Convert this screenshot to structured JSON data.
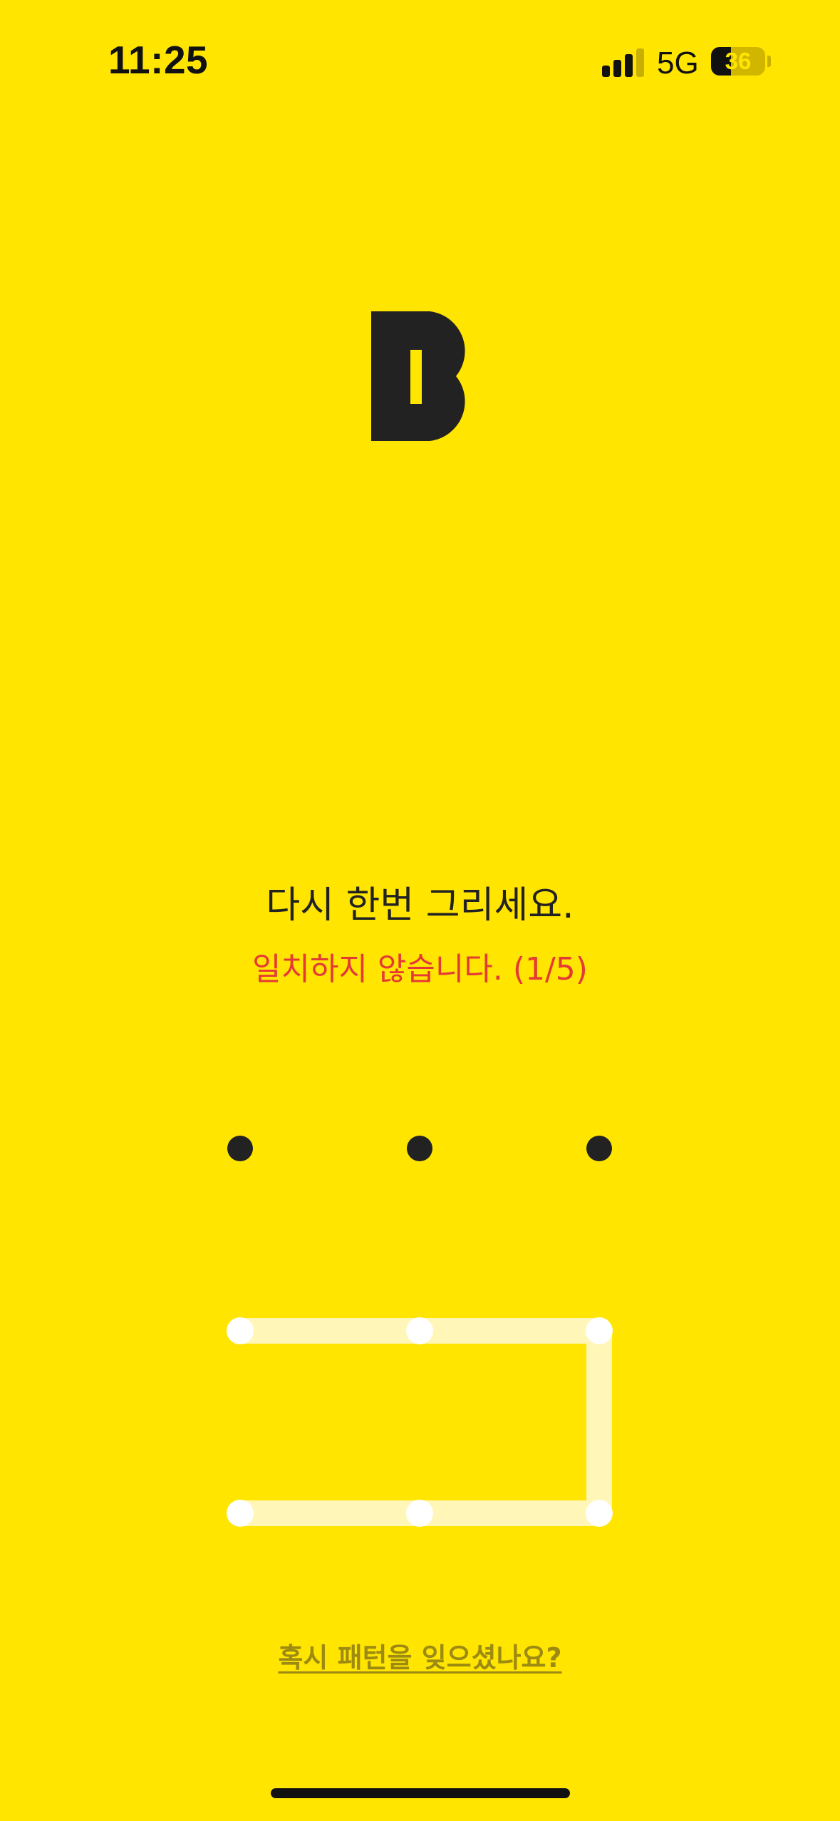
{
  "status_bar": {
    "time": "11:25",
    "network": "5G",
    "battery_percent": "36",
    "signal_bars_active": 3,
    "signal_bars_total": 4
  },
  "logo": {
    "icon": "bank-b-logo-icon"
  },
  "prompt": {
    "title": "다시 한번 그리세요.",
    "error": "일치하지 않습니다. (1/5)",
    "error_color": "#E53935"
  },
  "pattern": {
    "grid_size": 3,
    "drawn_path": [
      3,
      4,
      5,
      8,
      7,
      6
    ],
    "dot_color": "#222222",
    "line_color": "#FFF6B8"
  },
  "forgot_link": {
    "label": "혹시 패턴을 잊으셨나요?"
  },
  "colors": {
    "background": "#FFE500",
    "text": "#222222"
  }
}
